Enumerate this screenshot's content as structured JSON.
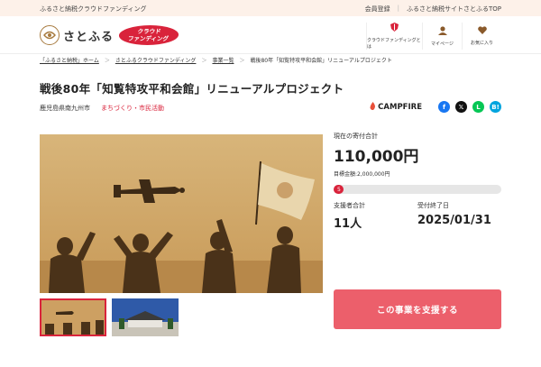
{
  "topbar": {
    "tagline": "ふるさと納税クラウドファンディング",
    "register": "会員登録",
    "site_top": "ふるさと納税サイトさとふるTOP"
  },
  "header": {
    "logo_mark": "ふるさと納税",
    "logo_text": "さとふる",
    "badge_line1": "クラウド",
    "badge_line2": "ファンディング",
    "nav": [
      {
        "label": "クラウドファンディングとは",
        "icon": "shield-icon"
      },
      {
        "label": "マイページ",
        "icon": "user-icon"
      },
      {
        "label": "お気に入り",
        "icon": "heart-icon"
      }
    ]
  },
  "breadcrumb": {
    "items": [
      "「ふるさと納税」ホーム",
      "さとふるクラウドファンディング",
      "事業一覧"
    ],
    "current": "戦後80年「知覧特攻平和会館」リニューアルプロジェクト",
    "separator": "＞"
  },
  "project": {
    "title": "戦後80年「知覧特攻平和会館」リニューアルプロジェクト",
    "location": "鹿児島県南九州市",
    "category": "まちづくり・市民活動"
  },
  "share": {
    "campfire": "CAMPFIRE",
    "facebook": "f",
    "x": "𝕏",
    "line": "L",
    "hatena": "B!"
  },
  "funding": {
    "current_label": "現在の寄付合計",
    "current_amount": "110,000円",
    "goal_label": "目標金額:2,000,000円",
    "progress_percent": 5,
    "progress_text": "5",
    "supporters_label": "支援者合計",
    "supporters_value": "11人",
    "deadline_label": "受付終了日",
    "deadline_value": "2025/01/31",
    "support_button": "この事業を支援する"
  },
  "colors": {
    "accent": "#d9233b",
    "button": "#ec5f6b",
    "topbar_bg": "#fdf1e9"
  }
}
